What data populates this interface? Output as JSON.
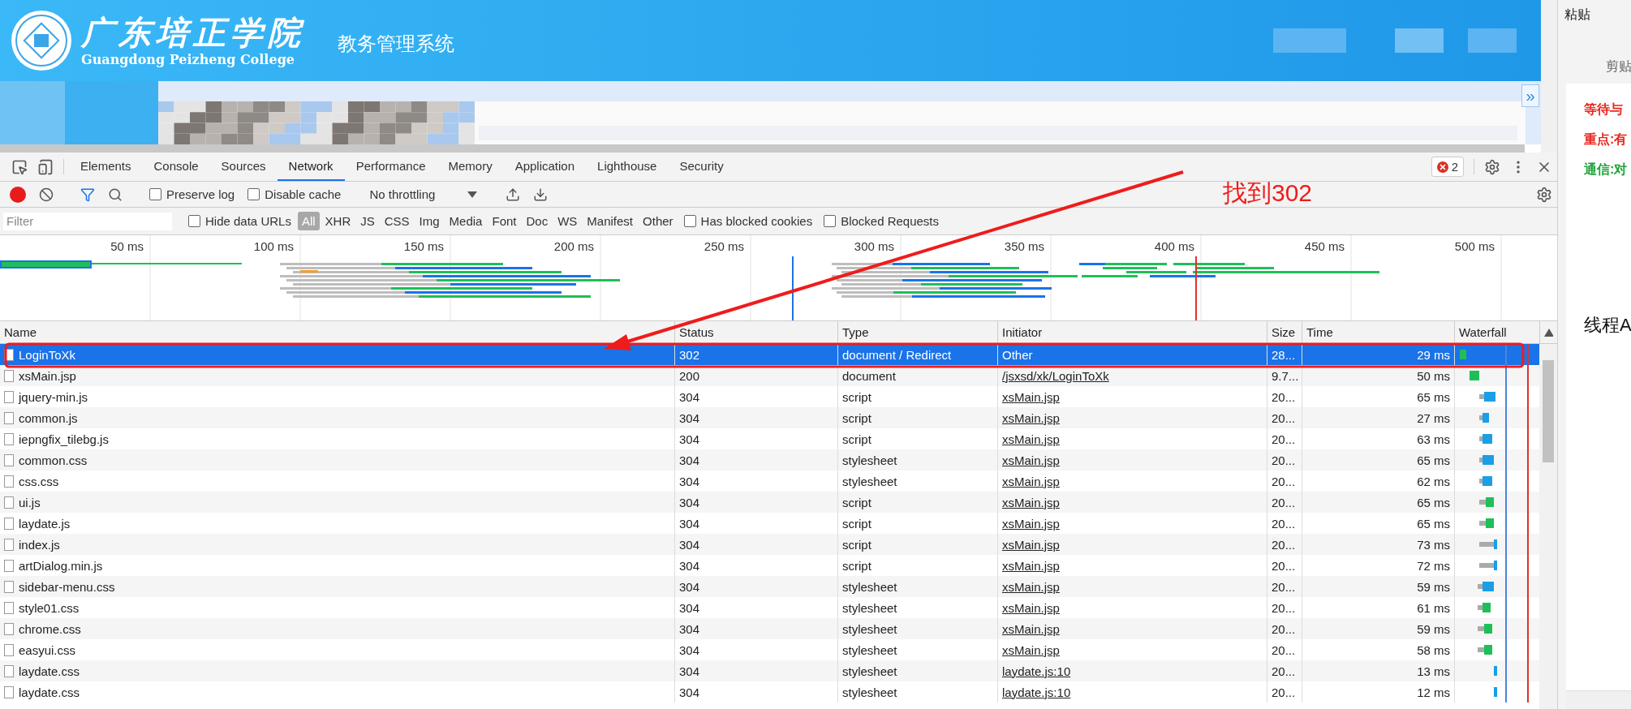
{
  "page": {
    "school_name": "广东培正学院",
    "school_name_en": "Guangdong Peizheng College",
    "system_title": "教务管理系统",
    "expand_button": "»"
  },
  "devtools": {
    "tabs": [
      {
        "label": "Elements",
        "selected": false
      },
      {
        "label": "Console",
        "selected": false
      },
      {
        "label": "Sources",
        "selected": false
      },
      {
        "label": "Network",
        "selected": true
      },
      {
        "label": "Performance",
        "selected": false
      },
      {
        "label": "Memory",
        "selected": false
      },
      {
        "label": "Application",
        "selected": false
      },
      {
        "label": "Lighthouse",
        "selected": false
      },
      {
        "label": "Security",
        "selected": false
      }
    ],
    "error_count": "2",
    "toolbar": {
      "recording": true,
      "preserve_log": {
        "label": "Preserve log",
        "checked": false
      },
      "disable_cache": {
        "label": "Disable cache",
        "checked": false
      },
      "throttling": "No throttling"
    },
    "filter": {
      "placeholder": "Filter",
      "hide_data_urls": {
        "label": "Hide data URLs",
        "checked": false
      },
      "types": [
        {
          "label": "All",
          "selected": true
        },
        {
          "label": "XHR",
          "selected": false
        },
        {
          "label": "JS",
          "selected": false
        },
        {
          "label": "CSS",
          "selected": false
        },
        {
          "label": "Img",
          "selected": false
        },
        {
          "label": "Media",
          "selected": false
        },
        {
          "label": "Font",
          "selected": false
        },
        {
          "label": "Doc",
          "selected": false
        },
        {
          "label": "WS",
          "selected": false
        },
        {
          "label": "Manifest",
          "selected": false
        },
        {
          "label": "Other",
          "selected": false
        }
      ],
      "has_blocked_cookies": {
        "label": "Has blocked cookies",
        "checked": false
      },
      "blocked_requests": {
        "label": "Blocked Requests",
        "checked": false
      }
    },
    "timeline_ticks": [
      "50 ms",
      "100 ms",
      "150 ms",
      "200 ms",
      "250 ms",
      "300 ms",
      "350 ms",
      "400 ms",
      "450 ms",
      "500 ms"
    ],
    "columns": [
      "Name",
      "Status",
      "Type",
      "Initiator",
      "Size",
      "Time",
      "Waterfall"
    ],
    "rows": [
      {
        "name": "LoginToXk",
        "status": "302",
        "type": "document / Redirect",
        "initiator": "Other",
        "initiator_link": false,
        "size": "28...",
        "time": "29 ms",
        "selected": true
      },
      {
        "name": "xsMain.jsp",
        "status": "200",
        "type": "document",
        "initiator": "/jsxsd/xk/LoginToXk",
        "initiator_link": true,
        "size": "9.7...",
        "time": "50 ms",
        "selected": false
      },
      {
        "name": "jquery-min.js",
        "status": "304",
        "type": "script",
        "initiator": "xsMain.jsp",
        "initiator_link": true,
        "size": "20...",
        "time": "65 ms",
        "selected": false
      },
      {
        "name": "common.js",
        "status": "304",
        "type": "script",
        "initiator": "xsMain.jsp",
        "initiator_link": true,
        "size": "20...",
        "time": "27 ms",
        "selected": false
      },
      {
        "name": "iepngfix_tilebg.js",
        "status": "304",
        "type": "script",
        "initiator": "xsMain.jsp",
        "initiator_link": true,
        "size": "20...",
        "time": "63 ms",
        "selected": false
      },
      {
        "name": "common.css",
        "status": "304",
        "type": "stylesheet",
        "initiator": "xsMain.jsp",
        "initiator_link": true,
        "size": "20...",
        "time": "65 ms",
        "selected": false
      },
      {
        "name": "css.css",
        "status": "304",
        "type": "stylesheet",
        "initiator": "xsMain.jsp",
        "initiator_link": true,
        "size": "20...",
        "time": "62 ms",
        "selected": false
      },
      {
        "name": "ui.js",
        "status": "304",
        "type": "script",
        "initiator": "xsMain.jsp",
        "initiator_link": true,
        "size": "20...",
        "time": "65 ms",
        "selected": false
      },
      {
        "name": "laydate.js",
        "status": "304",
        "type": "script",
        "initiator": "xsMain.jsp",
        "initiator_link": true,
        "size": "20...",
        "time": "65 ms",
        "selected": false
      },
      {
        "name": "index.js",
        "status": "304",
        "type": "script",
        "initiator": "xsMain.jsp",
        "initiator_link": true,
        "size": "20...",
        "time": "73 ms",
        "selected": false
      },
      {
        "name": "artDialog.min.js",
        "status": "304",
        "type": "script",
        "initiator": "xsMain.jsp",
        "initiator_link": true,
        "size": "20...",
        "time": "72 ms",
        "selected": false
      },
      {
        "name": "sidebar-menu.css",
        "status": "304",
        "type": "stylesheet",
        "initiator": "xsMain.jsp",
        "initiator_link": true,
        "size": "20...",
        "time": "59 ms",
        "selected": false
      },
      {
        "name": "style01.css",
        "status": "304",
        "type": "stylesheet",
        "initiator": "xsMain.jsp",
        "initiator_link": true,
        "size": "20...",
        "time": "61 ms",
        "selected": false
      },
      {
        "name": "chrome.css",
        "status": "304",
        "type": "stylesheet",
        "initiator": "xsMain.jsp",
        "initiator_link": true,
        "size": "20...",
        "time": "59 ms",
        "selected": false
      },
      {
        "name": "easyui.css",
        "status": "304",
        "type": "stylesheet",
        "initiator": "xsMain.jsp",
        "initiator_link": true,
        "size": "20...",
        "time": "58 ms",
        "selected": false
      },
      {
        "name": "laydate.css",
        "status": "304",
        "type": "stylesheet",
        "initiator": "laydate.js:10",
        "initiator_link": true,
        "size": "20...",
        "time": "13 ms",
        "selected": false
      },
      {
        "name": "laydate.css",
        "status": "304",
        "type": "stylesheet",
        "initiator": "laydate.js:10",
        "initiator_link": true,
        "size": "20...",
        "time": "12 ms",
        "selected": false
      }
    ]
  },
  "annotation": {
    "text": "找到302"
  },
  "side_panel": {
    "paste": "粘贴",
    "clipboard": "剪贴",
    "lines": [
      {
        "text": "等待与",
        "color": "#e8281e"
      },
      {
        "text": "重点:有",
        "color": "#e8281e"
      },
      {
        "text": "通信:对",
        "color": "#1fa33a"
      },
      {
        "text": "线程A",
        "color": "#111111"
      }
    ]
  }
}
